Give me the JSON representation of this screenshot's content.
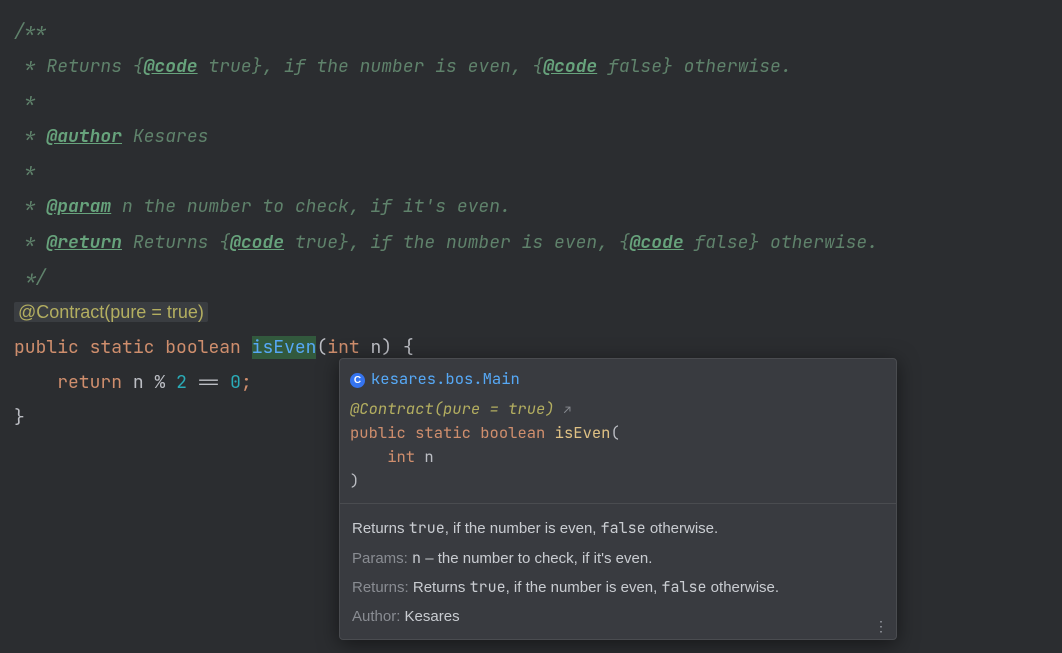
{
  "javadoc": {
    "open": "/**",
    "star": " *",
    "returns_prefix": " * Returns {",
    "code_tag": "@code",
    "true_word": " true",
    "mid1": "}, if the number is even, {",
    "false_word": " false",
    "end1": "} otherwise.",
    "author_tag": "@author",
    "author_name": " Kesares",
    "param_tag": "@param",
    "param_desc": " n the number to check, if it's even.",
    "return_tag": "@return",
    "return_prefix": " Returns {",
    "close": " */"
  },
  "code": {
    "annotation": "@Contract(pure = true)",
    "public": "public",
    "static": "static",
    "boolean": "boolean",
    "method": "isEven",
    "int": "int",
    "param": "n",
    "lbrace": "{",
    "return_kw": "return",
    "body_ident": "n",
    "pct": "%",
    "two": "2",
    "eq": "==",
    "zero": "0",
    "semi": ";",
    "rbrace": "}"
  },
  "popup": {
    "fqn": "kesares.bos.Main",
    "contract": "@Contract",
    "contract_args": "(pure = true)",
    "arrow": "↗",
    "public": "public",
    "static": "static",
    "boolean": "boolean",
    "method": "isEven",
    "lparen": "(",
    "int": "int",
    "param": "n",
    "rparen": ")",
    "desc_1": "Returns ",
    "desc_true": "true",
    "desc_2": ", if the number is even, ",
    "desc_false": "false",
    "desc_3": " otherwise.",
    "params_label": "Params:",
    "params_n": "n",
    "params_desc": " – the number to check, if it's even.",
    "returns_label": "Returns:",
    "returns_1": " Returns ",
    "returns_true": "true",
    "returns_2": ", if the number is even, ",
    "returns_false": "false",
    "returns_3": " otherwise.",
    "author_label": "Author:",
    "author_val": "  Kesares"
  }
}
